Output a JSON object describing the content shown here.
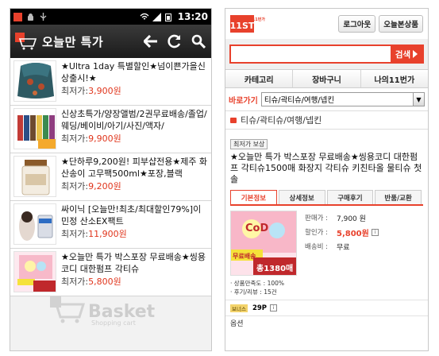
{
  "left": {
    "status": {
      "time": "13:20"
    },
    "appbar": {
      "title": "오늘만 특가"
    },
    "items": [
      {
        "name": "★Ultra 1day 특별할인★넘이쁜가을신상출시!★",
        "price_label": "최저가:",
        "price": "3,900원"
      },
      {
        "name": "신상초특가/양장앨범/2권무료배송/졸업/웨딩/베이비/아기/사진/액자/",
        "price_label": "최저가:",
        "price": "9,900원"
      },
      {
        "name": "★단하루9,200원! 피부샵전용★제주 화산송이 고무팩500ml★포장,블랙",
        "price_label": "최저가:",
        "price": "9,200원"
      },
      {
        "name": "싸이닉 [오늘만!최초/최대할인79%]이민정 산소EX팩트",
        "price_label": "최저가:",
        "price": "11,900원"
      },
      {
        "name": "★오늘만 특가 박스포장 무료배송★씽용코디 대한펌프 각티슈",
        "price_label": "최저가:",
        "price": "5,800원"
      }
    ],
    "watermark": {
      "text": "Basket",
      "sub": "Shopping cart"
    }
  },
  "right": {
    "logo": {
      "text": "11ST",
      "sub": "11번가"
    },
    "top_buttons": [
      "로그아웃",
      "오늘본상품"
    ],
    "search": {
      "button": "검색",
      "placeholder": ""
    },
    "nav": [
      "카테고리",
      "장바구니",
      "나의11번가"
    ],
    "shortcut": {
      "label": "바로가기",
      "value": "티슈/곽티슈/여행/넵킨"
    },
    "category": "티슈/곽티슈/여행/넵킨",
    "product": {
      "badge": "최저가 보상",
      "title": "★오늘만 특가 박스포장 무료배송★씽용코디 대한펌프 각티슈1500매 화장지 각티슈 키친타올 물티슈 첫솔",
      "tabs": [
        "기본정보",
        "상세정보",
        "구매후기",
        "반품/교환"
      ],
      "info": [
        {
          "k": "판매가 :",
          "v": "7,900 원"
        },
        {
          "k": "할인가 :",
          "v": "5,800원"
        },
        {
          "k": "배송비 :",
          "v": "무료"
        }
      ],
      "stats": [
        "· 상품만족도 : 100%",
        "· 후기/리뷰 : 15건"
      ],
      "bonus": {
        "tag": "보너스",
        "points": "29P",
        "footer": "옵션"
      },
      "image_text": {
        "top": "CoD",
        "sticker": "무료배송",
        "badge": "총1380매"
      }
    }
  }
}
